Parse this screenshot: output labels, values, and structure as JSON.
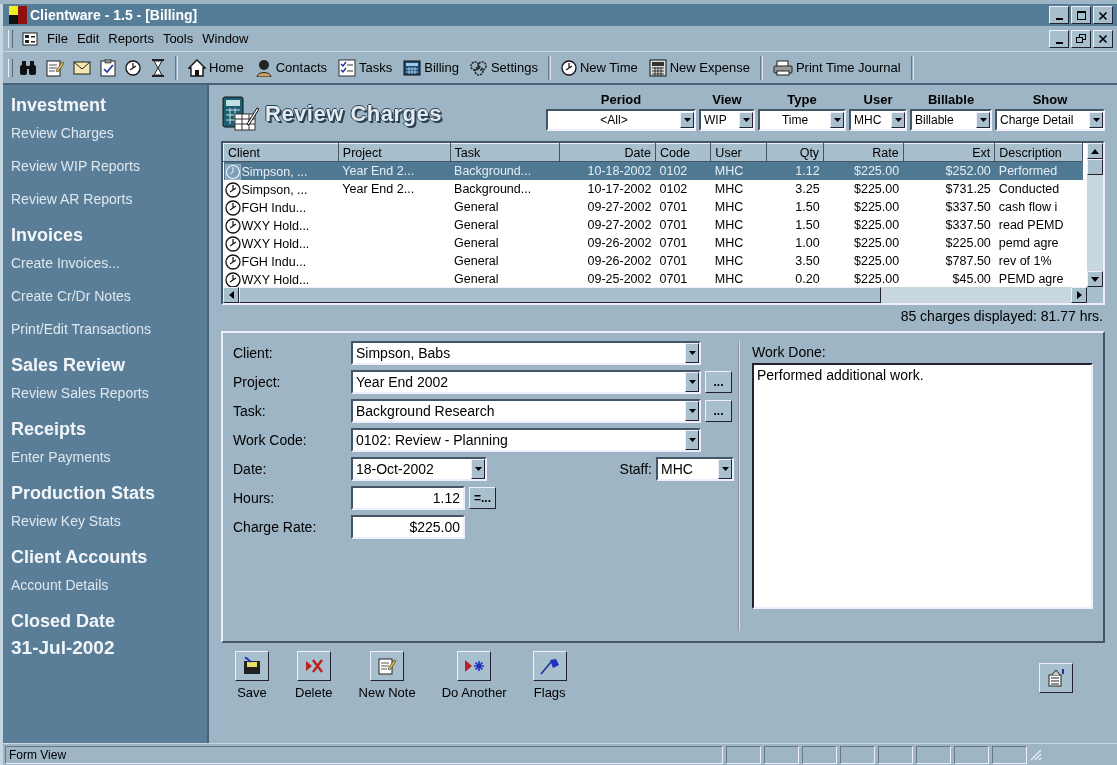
{
  "window": {
    "title": "Clientware - 1.5 - [Billing]"
  },
  "menu": [
    "File",
    "Edit",
    "Reports",
    "Tools",
    "Window"
  ],
  "toolbar": {
    "nav": [
      "Home",
      "Contacts",
      "Tasks",
      "Billing",
      "Settings"
    ],
    "actions": [
      "New Time",
      "New Expense",
      "Print Time Journal"
    ]
  },
  "sidebar": {
    "sections": [
      {
        "heading": "Investment",
        "items": [
          "Review Charges",
          "Review WIP Reports",
          "Review AR Reports"
        ]
      },
      {
        "heading": "Invoices",
        "items": [
          "Create Invoices...",
          "Create Cr/Dr Notes",
          "Print/Edit Transactions"
        ]
      },
      {
        "heading": "Sales Review",
        "items": [
          "Review Sales Reports"
        ]
      },
      {
        "heading": "Receipts",
        "items": [
          "Enter Payments"
        ]
      },
      {
        "heading": "Production Stats",
        "items": [
          "Review Key Stats"
        ]
      },
      {
        "heading": "Client Accounts",
        "items": [
          "Account Details"
        ]
      },
      {
        "heading": "Closed Date",
        "value": "31-Jul-2002"
      }
    ]
  },
  "page": {
    "title": "Review Charges",
    "filters": [
      {
        "label": "Period",
        "value": "<All>"
      },
      {
        "label": "View",
        "value": "WIP"
      },
      {
        "label": "Type",
        "value": "Time"
      },
      {
        "label": "User",
        "value": "MHC"
      },
      {
        "label": "Billable",
        "value": "Billable"
      },
      {
        "label": "Show",
        "value": "Charge Detail"
      }
    ]
  },
  "table": {
    "columns": [
      {
        "label": "Client"
      },
      {
        "label": "Project"
      },
      {
        "label": "Task"
      },
      {
        "label": "Date"
      },
      {
        "label": "Code"
      },
      {
        "label": "User"
      },
      {
        "label": "Qty"
      },
      {
        "label": "Rate"
      },
      {
        "label": "Ext"
      },
      {
        "label": "Description"
      }
    ],
    "rows": [
      {
        "selected": true,
        "cells": [
          "Simpson, ...",
          "Year End 2...",
          "Background...",
          "10-18-2002",
          "0102",
          "MHC",
          "1.12",
          "$225.00",
          "$252.00",
          "Performed"
        ]
      },
      {
        "selected": false,
        "cells": [
          "Simpson, ...",
          "Year End 2...",
          "Background...",
          "10-17-2002",
          "0102",
          "MHC",
          "3.25",
          "$225.00",
          "$731.25",
          "Conducted"
        ]
      },
      {
        "selected": false,
        "cells": [
          "FGH Indu...",
          "",
          "General",
          "09-27-2002",
          "0701",
          "MHC",
          "1.50",
          "$225.00",
          "$337.50",
          "cash flow i"
        ]
      },
      {
        "selected": false,
        "cells": [
          "WXY Hold...",
          "",
          "General",
          "09-27-2002",
          "0701",
          "MHC",
          "1.50",
          "$225.00",
          "$337.50",
          "read PEMD"
        ]
      },
      {
        "selected": false,
        "cells": [
          "WXY Hold...",
          "",
          "General",
          "09-26-2002",
          "0701",
          "MHC",
          "1.00",
          "$225.00",
          "$225.00",
          "pemd agre"
        ]
      },
      {
        "selected": false,
        "cells": [
          "FGH Indu...",
          "",
          "General",
          "09-26-2002",
          "0701",
          "MHC",
          "3.50",
          "$225.00",
          "$787.50",
          "rev of 1%"
        ]
      },
      {
        "selected": false,
        "cells": [
          "WXY Hold...",
          "",
          "General",
          "09-25-2002",
          "0701",
          "MHC",
          "0.20",
          "$225.00",
          "$45.00",
          "PEMD agre"
        ]
      }
    ]
  },
  "count": "85 charges displayed: 81.77 hrs.",
  "form": {
    "fields": [
      {
        "label": "Client:",
        "kind": "combo",
        "value": "Simpson, Babs"
      },
      {
        "label": "Project:",
        "kind": "combo",
        "value": "Year End 2002",
        "button": "..."
      },
      {
        "label": "Task:",
        "kind": "combo",
        "value": "Background Research",
        "button": "..."
      },
      {
        "label": "Work Code:",
        "kind": "combo",
        "value": "0102: Review - Planning"
      },
      {
        "label": "Date:",
        "kind": "combo",
        "value": "18-Oct-2002",
        "side": {
          "label": "Staff:",
          "value": "MHC"
        }
      },
      {
        "label": "Hours:",
        "kind": "text",
        "value": "1.12",
        "button": "=..."
      },
      {
        "label": "Charge Rate:",
        "kind": "text",
        "value": "$225.00"
      }
    ],
    "notes": {
      "label": "Work Done:",
      "value": "Performed additional work."
    }
  },
  "actions": [
    "Save",
    "Delete",
    "New Note",
    "Do Another",
    "Flags"
  ],
  "status_bar": {
    "text": "Form View"
  }
}
